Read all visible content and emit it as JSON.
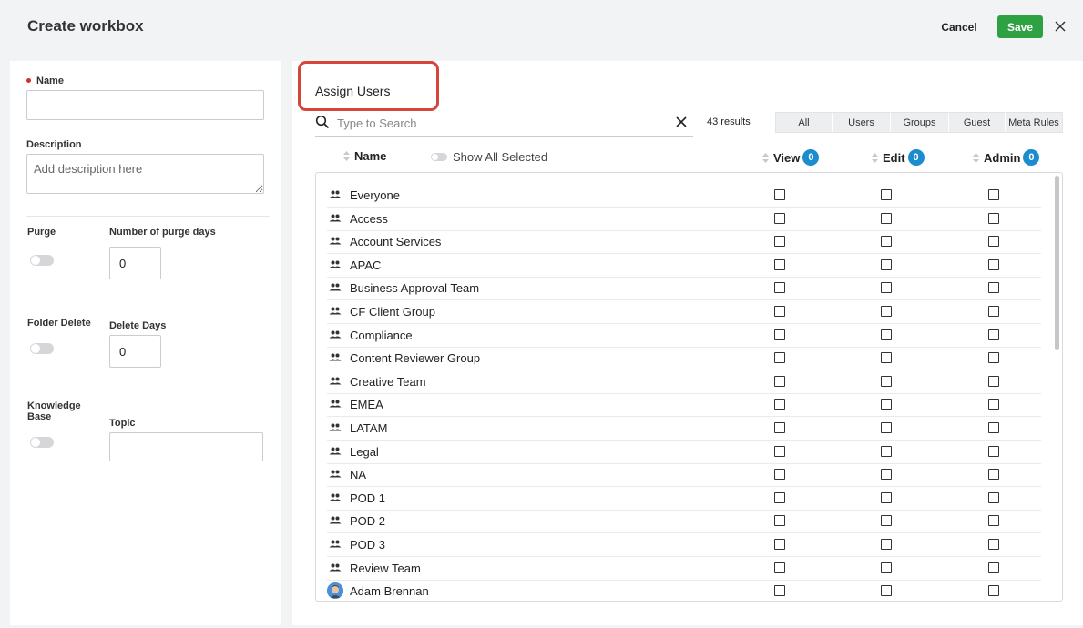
{
  "header": {
    "title": "Create workbox",
    "cancel_label": "Cancel",
    "save_label": "Save",
    "save_color": "#2ea143"
  },
  "form": {
    "name_label": "Name",
    "name_value": "",
    "description_label": "Description",
    "description_placeholder": "Add description here",
    "purge_label": "Purge",
    "purge_days_label": "Number of purge days",
    "purge_days_value": "0",
    "folder_delete_label": "Folder Delete",
    "delete_days_label": "Delete Days",
    "delete_days_value": "0",
    "knowledge_base_label_1": "Knowledge",
    "knowledge_base_label_2": "Base",
    "topic_label": "Topic",
    "topic_value": "",
    "purge_enabled": false,
    "folder_delete_enabled": false,
    "knowledge_base_enabled": false
  },
  "assign": {
    "title": "Assign Users",
    "search_placeholder": "Type to Search",
    "results": "43 results",
    "filter_tabs": [
      "All",
      "Users",
      "Groups",
      "Guest",
      "Meta Rules"
    ],
    "columns": {
      "name": "Name",
      "show_all_selected": "Show All Selected",
      "view": "View",
      "view_count": "0",
      "edit": "Edit",
      "edit_count": "0",
      "admin": "Admin",
      "admin_count": "0"
    },
    "rows": [
      {
        "label": "Everyone",
        "type": "group"
      },
      {
        "label": "Access",
        "type": "group"
      },
      {
        "label": "Account Services",
        "type": "group"
      },
      {
        "label": "APAC",
        "type": "group"
      },
      {
        "label": "Business Approval Team",
        "type": "group"
      },
      {
        "label": "CF Client Group",
        "type": "group"
      },
      {
        "label": "Compliance",
        "type": "group"
      },
      {
        "label": "Content Reviewer Group",
        "type": "group"
      },
      {
        "label": "Creative Team",
        "type": "group"
      },
      {
        "label": "EMEA",
        "type": "group"
      },
      {
        "label": "LATAM",
        "type": "group"
      },
      {
        "label": "Legal",
        "type": "group"
      },
      {
        "label": "NA",
        "type": "group"
      },
      {
        "label": "POD 1",
        "type": "group"
      },
      {
        "label": "POD 2",
        "type": "group"
      },
      {
        "label": "POD 3",
        "type": "group"
      },
      {
        "label": "Review Team",
        "type": "group"
      },
      {
        "label": "Adam Brennan",
        "type": "user"
      }
    ],
    "badge_color": "#1c8ccf",
    "highlight_color": "#d6453a"
  }
}
